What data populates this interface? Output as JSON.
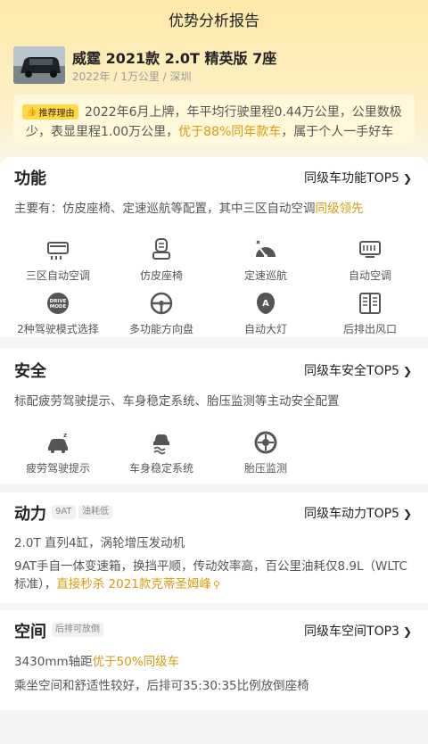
{
  "header": {
    "title": "优势分析报告"
  },
  "car": {
    "name": "威霆 2021款 2.0T 精英版 7座",
    "meta": "2022年 / 1万公里 / 深圳"
  },
  "recommend": {
    "badge": "推荐理由",
    "line1": "2022年6月上牌，年平均行驶里程0.44万公里，公里数极",
    "line2_a": "少，表显里程1.00万公里，",
    "line2_hl": "优于88%同年款车",
    "line2_b": "，属于个人一手好车"
  },
  "function": {
    "title": "功能",
    "link": "同级车功能TOP5",
    "desc_a": "主要有：仿皮座椅、定速巡航等配置，其中三区自动空调",
    "desc_hl": "同级领先",
    "features": [
      {
        "label": "三区自动空调",
        "icon": "ac-icon"
      },
      {
        "label": "仿皮座椅",
        "icon": "seat-icon"
      },
      {
        "label": "定速巡航",
        "icon": "cruise-icon"
      },
      {
        "label": "自动空调",
        "icon": "auto-ac-icon"
      },
      {
        "label": "2种驾驶模式选择",
        "icon": "drive-mode-icon",
        "icon_text": "DRIVE MODE"
      },
      {
        "label": "多功能方向盘",
        "icon": "steering-wheel-icon"
      },
      {
        "label": "自动大灯",
        "icon": "headlight-icon",
        "icon_text": "A"
      },
      {
        "label": "后排出风口",
        "icon": "rear-vent-icon"
      }
    ]
  },
  "safety": {
    "title": "安全",
    "link": "同级车安全TOP5",
    "desc": "标配疲劳驾驶提示、车身稳定系统、胎压监测等主动安全配置",
    "features": [
      {
        "label": "疲劳驾驶提示",
        "icon": "fatigue-icon"
      },
      {
        "label": "车身稳定系统",
        "icon": "stability-icon"
      },
      {
        "label": "胎压监测",
        "icon": "tire-pressure-icon"
      }
    ]
  },
  "power": {
    "title": "动力",
    "tags": [
      "9AT",
      "油耗低"
    ],
    "link": "同级车动力TOP5",
    "line1": "2.0T 直列4缸，涡轮增压发动机",
    "line2": "9AT手自一体变速箱，换挡平顺，传动效率高，百公里油耗仅8.9L（WLTC",
    "line3_a": "标准），",
    "line3_hl": "直接秒杀 2021款克蒂圣姆峰"
  },
  "space": {
    "title": "空间",
    "tags": [
      "后排可放倒"
    ],
    "link": "同级车空间TOP3",
    "line1_a": "3430mm轴距",
    "line1_hl": "优于50%同级车",
    "line2": "乘坐空间和舒适性较好，后排可35:30:35比例放倒座椅"
  },
  "colors": {
    "accent": "#d99a10",
    "badge": "#ffd94a",
    "icon": "#555555"
  }
}
